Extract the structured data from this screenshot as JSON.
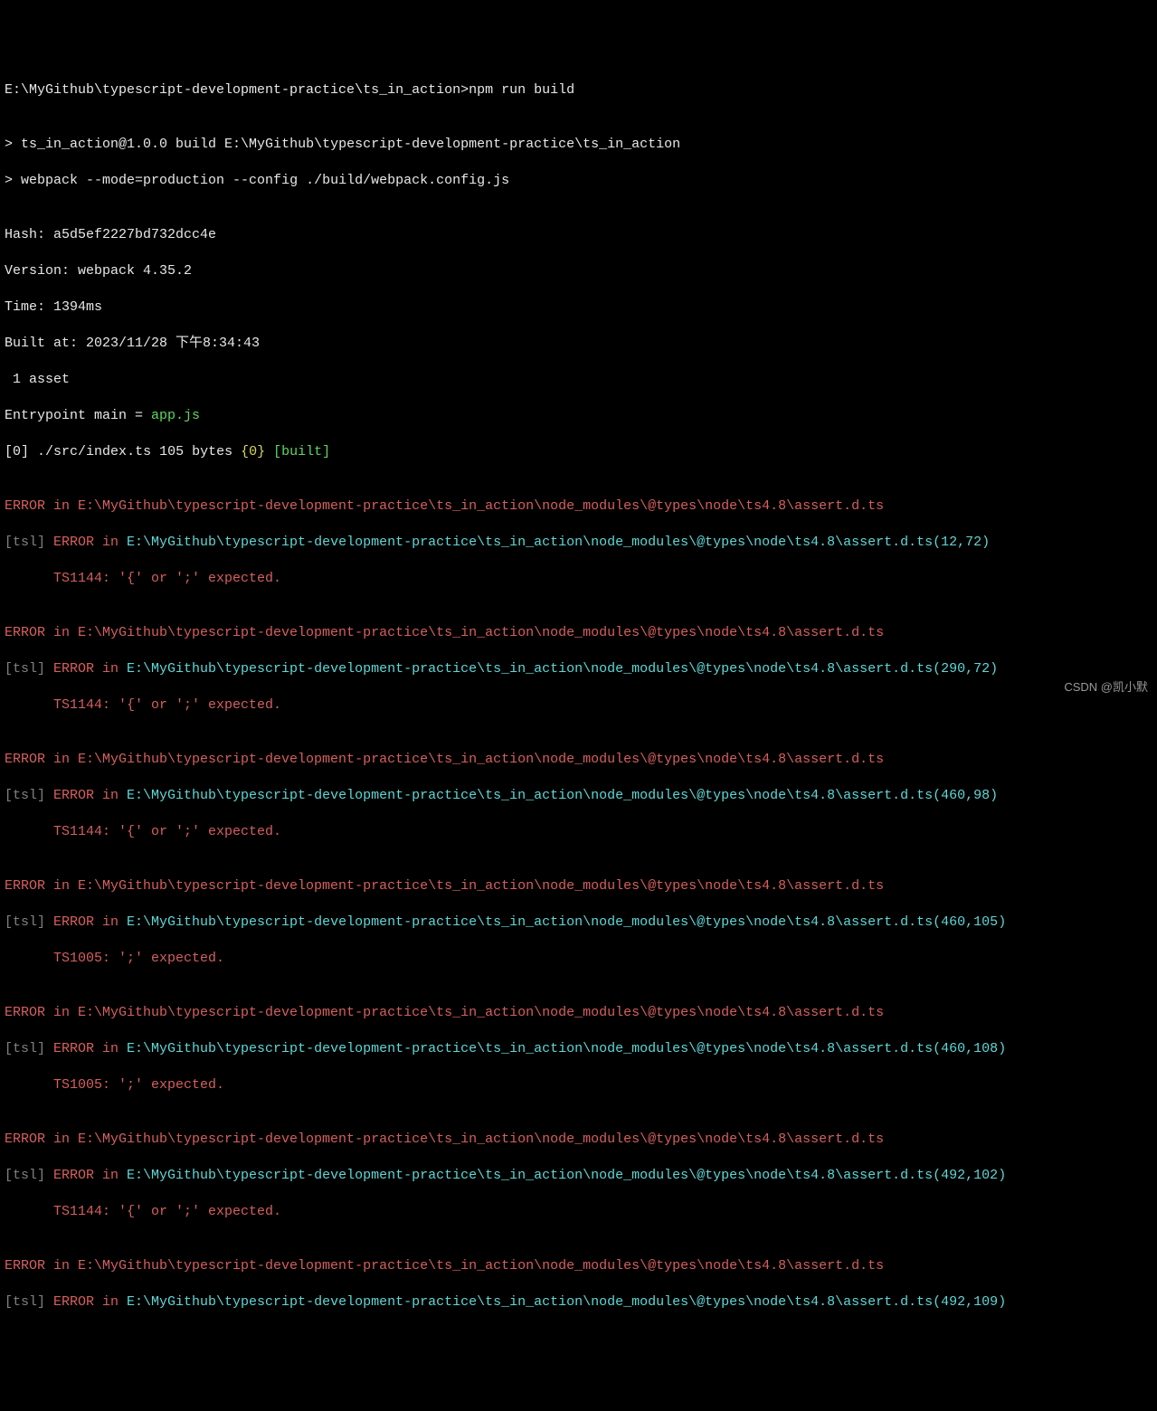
{
  "prompt": {
    "path": "E:\\MyGithub\\typescript-development-practice\\ts_in_action>",
    "command": "npm run build"
  },
  "build_header": {
    "line1_prefix": "> ",
    "line1": "ts_in_action@1.0.0 build E:\\MyGithub\\typescript-development-practice\\ts_in_action",
    "line2_prefix": "> ",
    "line2": "webpack --mode=production --config ./build/webpack.config.js"
  },
  "stats": {
    "hash_label": "Hash: ",
    "hash": "a5d5ef2227bd732dcc4e",
    "version_label": "Version: ",
    "version": "webpack 4.35.2",
    "time_label": "Time: ",
    "time": "1394ms",
    "built_at_label": "Built at: ",
    "built_at": "2023/11/28 下午8:34:43",
    "asset": " 1 asset",
    "entrypoint_prefix": "Entrypoint main = ",
    "entrypoint_file": "app.js",
    "module_idx_open": "[",
    "module_idx": "0",
    "module_idx_close": "] ",
    "module_path": "./src/index.ts 105 bytes ",
    "module_chunk_open": "{",
    "module_chunk": "0",
    "module_chunk_close": "} ",
    "module_built": "[built]"
  },
  "errors": [
    {
      "header": "ERROR in E:\\MyGithub\\typescript-development-practice\\ts_in_action\\node_modules\\@types\\node\\ts4.8\\assert.d.ts",
      "tsl": "[tsl] ",
      "err_in": "ERROR in ",
      "path": "E:\\MyGithub\\typescript-development-practice\\ts_in_action\\node_modules\\@types\\node\\ts4.8\\assert.d.ts(12,72)",
      "code": "      TS1144: '{' or ';' expected."
    },
    {
      "header": "ERROR in E:\\MyGithub\\typescript-development-practice\\ts_in_action\\node_modules\\@types\\node\\ts4.8\\assert.d.ts",
      "tsl": "[tsl] ",
      "err_in": "ERROR in ",
      "path": "E:\\MyGithub\\typescript-development-practice\\ts_in_action\\node_modules\\@types\\node\\ts4.8\\assert.d.ts(290,72)",
      "code": "      TS1144: '{' or ';' expected."
    },
    {
      "header": "ERROR in E:\\MyGithub\\typescript-development-practice\\ts_in_action\\node_modules\\@types\\node\\ts4.8\\assert.d.ts",
      "tsl": "[tsl] ",
      "err_in": "ERROR in ",
      "path": "E:\\MyGithub\\typescript-development-practice\\ts_in_action\\node_modules\\@types\\node\\ts4.8\\assert.d.ts(460,98)",
      "code": "      TS1144: '{' or ';' expected."
    },
    {
      "header": "ERROR in E:\\MyGithub\\typescript-development-practice\\ts_in_action\\node_modules\\@types\\node\\ts4.8\\assert.d.ts",
      "tsl": "[tsl] ",
      "err_in": "ERROR in ",
      "path": "E:\\MyGithub\\typescript-development-practice\\ts_in_action\\node_modules\\@types\\node\\ts4.8\\assert.d.ts(460,105)",
      "code": "      TS1005: ';' expected."
    },
    {
      "header": "ERROR in E:\\MyGithub\\typescript-development-practice\\ts_in_action\\node_modules\\@types\\node\\ts4.8\\assert.d.ts",
      "tsl": "[tsl] ",
      "err_in": "ERROR in ",
      "path": "E:\\MyGithub\\typescript-development-practice\\ts_in_action\\node_modules\\@types\\node\\ts4.8\\assert.d.ts(460,108)",
      "code": "      TS1005: ';' expected."
    },
    {
      "header": "ERROR in E:\\MyGithub\\typescript-development-practice\\ts_in_action\\node_modules\\@types\\node\\ts4.8\\assert.d.ts",
      "tsl": "[tsl] ",
      "err_in": "ERROR in ",
      "path": "E:\\MyGithub\\typescript-development-practice\\ts_in_action\\node_modules\\@types\\node\\ts4.8\\assert.d.ts(492,102)",
      "code": "      TS1144: '{' or ';' expected."
    },
    {
      "header": "ERROR in E:\\MyGithub\\typescript-development-practice\\ts_in_action\\node_modules\\@types\\node\\ts4.8\\assert.d.ts",
      "tsl": "[tsl] ",
      "err_in": "ERROR in ",
      "path": "E:\\MyGithub\\typescript-development-practice\\ts_in_action\\node_modules\\@types\\node\\ts4.8\\assert.d.ts(492,109)",
      "code": ""
    }
  ],
  "watermark": "CSDN @凯小默"
}
